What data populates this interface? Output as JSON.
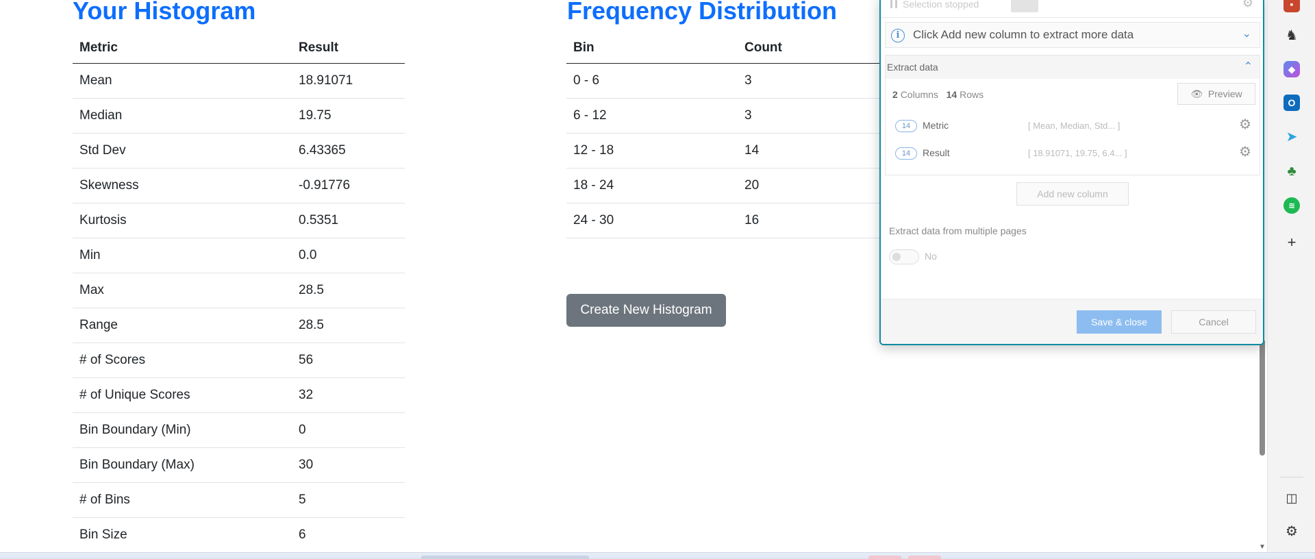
{
  "left_section": {
    "title": "Your Histogram",
    "headers": [
      "Metric",
      "Result"
    ],
    "rows": [
      [
        "Mean",
        "18.91071"
      ],
      [
        "Median",
        "19.75"
      ],
      [
        "Std Dev",
        "6.43365"
      ],
      [
        "Skewness",
        "-0.91776"
      ],
      [
        "Kurtosis",
        "0.5351"
      ],
      [
        "Min",
        "0.0"
      ],
      [
        "Max",
        "28.5"
      ],
      [
        "Range",
        "28.5"
      ],
      [
        "# of Scores",
        "56"
      ],
      [
        "# of Unique Scores",
        "32"
      ],
      [
        "Bin Boundary (Min)",
        "0"
      ],
      [
        "Bin Boundary (Max)",
        "30"
      ],
      [
        "# of Bins",
        "5"
      ],
      [
        "Bin Size",
        "6"
      ]
    ]
  },
  "right_section": {
    "title": "Frequency Distribution",
    "headers": [
      "Bin",
      "Count"
    ],
    "rows": [
      [
        "0 - 6",
        "3"
      ],
      [
        "6 - 12",
        "3"
      ],
      [
        "12 - 18",
        "14"
      ],
      [
        "18 - 24",
        "20"
      ],
      [
        "24 - 30",
        "16"
      ]
    ],
    "button_label": "Create New Histogram"
  },
  "extension_panel": {
    "selection_status": "Selection stopped",
    "info_text": "Click Add new column to extract more data",
    "extract_header": "Extract data",
    "columns_count": "2",
    "columns_label": "Columns",
    "rows_count": "14",
    "rows_label": "Rows",
    "preview_label": "Preview",
    "columns": [
      {
        "badge": "14",
        "name": "Metric",
        "values": "[ Mean, Median, Std... ]"
      },
      {
        "badge": "14",
        "name": "Result",
        "values": "[ 18.91071, 19.75, 6.4... ]"
      }
    ],
    "add_column_label": "Add new column",
    "multi_page_label": "Extract data from multiple pages",
    "multi_page_value": "No",
    "save_label": "Save & close",
    "cancel_label": "Cancel"
  },
  "sidebar": {
    "icons": [
      "toolbox-icon",
      "chess-icon",
      "copilot-icon",
      "outlook-icon",
      "send-icon",
      "tree-icon",
      "spotify-icon",
      "add-icon",
      "split-screen-icon",
      "settings-icon"
    ],
    "colors": {
      "outlook": "#0f6cbd",
      "spotify": "#1db954",
      "accent": "#0d6efd"
    }
  }
}
